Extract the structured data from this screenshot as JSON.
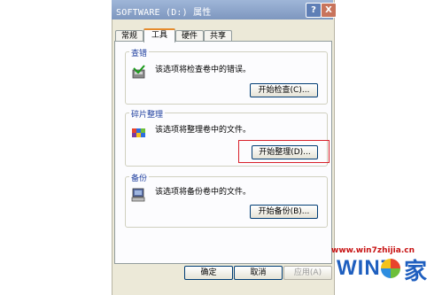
{
  "window": {
    "title": "SOFTWARE (D:) 属性",
    "help_label": "?",
    "close_label": "X"
  },
  "tabs": [
    {
      "label": "常规",
      "active": false
    },
    {
      "label": "工具",
      "active": true
    },
    {
      "label": "硬件",
      "active": false
    },
    {
      "label": "共享",
      "active": false
    }
  ],
  "groups": {
    "check": {
      "label": "查错",
      "description": "该选项将检查卷中的错误。",
      "button": "开始检查(C)...",
      "icon": "disk-check-icon"
    },
    "defrag": {
      "label": "碎片整理",
      "description": "该选项将整理卷中的文件。",
      "button": "开始整理(D)...",
      "icon": "defrag-icon"
    },
    "backup": {
      "label": "备份",
      "description": "该选项将备份卷中的文件。",
      "button": "开始备份(B)...",
      "icon": "backup-icon"
    }
  },
  "footer": {
    "ok": "确定",
    "cancel": "取消",
    "apply": "应用(A)"
  },
  "watermark": {
    "url": "www.win7zhijia.cn",
    "brand": "WIN7",
    "brand_suffix": "家"
  },
  "colors": {
    "highlight_box": "#d8202a",
    "titlebar": "#7e97bf",
    "active_tab_accent": "#e68b2c",
    "group_label": "#1f3f9f"
  }
}
